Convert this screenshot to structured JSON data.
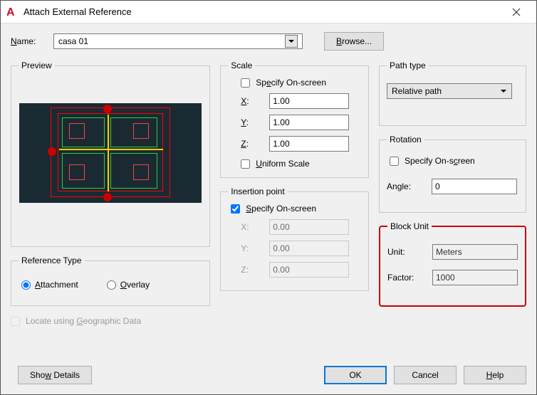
{
  "window": {
    "title": "Attach External Reference"
  },
  "name": {
    "label": "Name:",
    "value": "casa 01",
    "browse": "Browse..."
  },
  "preview": {
    "legend": "Preview"
  },
  "reference_type": {
    "legend": "Reference Type",
    "attachment": "Attachment",
    "overlay": "Overlay"
  },
  "locate_geo": "Locate using Geographic Data",
  "scale": {
    "legend": "Scale",
    "specify": "Specify On-screen",
    "x_label": "X:",
    "x": "1.00",
    "y_label": "Y:",
    "y": "1.00",
    "z_label": "Z:",
    "z": "1.00",
    "uniform": "Uniform Scale"
  },
  "insertion": {
    "legend": "Insertion point",
    "specify": "Specify On-screen",
    "x_label": "X:",
    "x": "0.00",
    "y_label": "Y:",
    "y": "0.00",
    "z_label": "Z:",
    "z": "0.00"
  },
  "path_type": {
    "legend": "Path type",
    "value": "Relative path"
  },
  "rotation": {
    "legend": "Rotation",
    "specify": "Specify On-screen",
    "angle_label": "Angle:",
    "angle": "0"
  },
  "block_unit": {
    "legend": "Block Unit",
    "unit_label": "Unit:",
    "unit": "Meters",
    "factor_label": "Factor:",
    "factor": "1000"
  },
  "buttons": {
    "show_details": "Show Details",
    "ok": "OK",
    "cancel": "Cancel",
    "help": "Help"
  }
}
